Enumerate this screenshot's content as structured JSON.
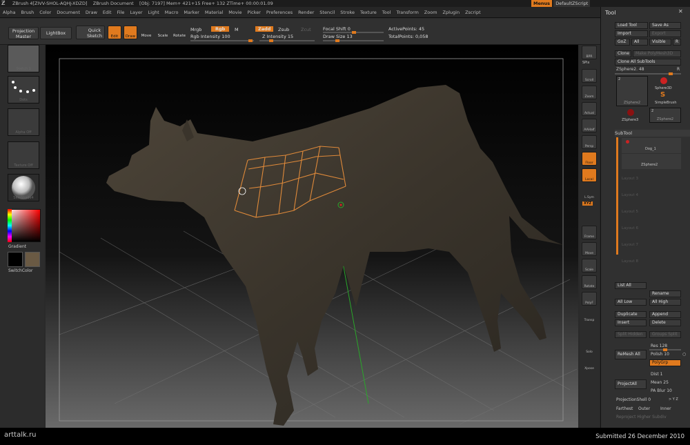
{
  "titlebar": {
    "app": "ZBrush 4[ZIVV-SHOL-AQHJ-XDZD]",
    "doc": "ZBrush Document",
    "info": "[Obj: 7197]  Mem+ 421+15  Free+ 132  ZTime+ 00:00:01.09"
  },
  "topright": {
    "menus": "Menus",
    "script": "DefaultZScript"
  },
  "menubar": [
    "Alpha",
    "Brush",
    "Color",
    "Document",
    "Draw",
    "Edit",
    "File",
    "Layer",
    "Light",
    "Macro",
    "Marker",
    "Material",
    "Movie",
    "Picker",
    "Preferences",
    "Render",
    "Stencil",
    "Stroke",
    "Texture",
    "Tool",
    "Transform",
    "Zoom",
    "Zplugin",
    "Zscript"
  ],
  "toolbar": {
    "projection_master": "Projection Master",
    "lightbox": "LightBox",
    "quick_sketch": "Quick Sketch",
    "edit": "Edit",
    "draw": "Draw",
    "move": "Move",
    "scale": "Scale",
    "rotate": "Rotate",
    "mrgb": "Mrgb",
    "rgb": "Rgb",
    "m": "M",
    "rgb_intensity": "Rgb Intensity 100",
    "zadd": "Zadd",
    "zsub": "Zsub",
    "zcut": "Zcut",
    "z_intensity": "Z Intensity 15",
    "focal_shift": "Focal Shift 0",
    "draw_size": "Draw Size 13",
    "active_points": "ActivePoints: 45",
    "total_points": "TotalPoints: 0,058"
  },
  "leftshelf": {
    "thumb1": "Sketch 1",
    "thumb2": "Dots",
    "thumb3": "Alpha Off",
    "thumb4": "Texture Off",
    "thumb5": "SkinShade4",
    "gradient": "Gradient",
    "switchcolor": "SwitchColor"
  },
  "rightshelf": [
    "BPR",
    "SPix",
    "Scroll",
    "Zoom",
    "Actual",
    "AAHalf",
    "Persp",
    "Floor",
    "Local",
    "L.Sym",
    "XYZ",
    "Frame",
    "Move",
    "Scale",
    "Rotate",
    "PolyF",
    "Transp",
    "Solo",
    "Xpose"
  ],
  "panel": {
    "title": "Tool",
    "load": "Load Tool",
    "saveas": "Save As",
    "import": "Import",
    "export": "Export",
    "goz": "GoZ",
    "all": "All",
    "visible": "Visible",
    "r": "R",
    "clone": "Clone",
    "make_poly": "Make PolyMesh3D",
    "clone_all": "Clone All SubTools",
    "zsphere": "ZSphere2. 48",
    "r2": "R",
    "t_count": "2",
    "t1": "ZSphere2",
    "t2": "Sphere3D",
    "t3": "SimpleBrush",
    "t4": "ZSphere3",
    "t5_count": "2",
    "t5": "ZSphere2",
    "subtool": "SubTool",
    "st1": "Dog_1",
    "st2": "ZSphere2",
    "layers": [
      "Layout 3",
      "Layout 4",
      "Layout 5",
      "Layout 6",
      "Layout 7",
      "Layout 8"
    ],
    "list_all": "List All",
    "rename": "Rename",
    "all_low": "All Low",
    "all_high": "All High",
    "duplicate": "Duplicate",
    "append": "Append",
    "insert": "Insert",
    "delete": "Delete",
    "split_hidden": "Split Hidden",
    "groups_split": "Groups Split",
    "remesh_all": "ReMesh All",
    "res": "Res 128",
    "polish": "Polish 10",
    "polygrp": "PolyGrp",
    "project_all": "ProjectAll",
    "dist": "Dist 1",
    "mean": "Mean 25",
    "pa_blur": "PA Blur 10",
    "projection_shell": "ProjectionShell 0",
    "xyz": "> Y Z",
    "farthest": "Farthest",
    "outer": "Outer",
    "inner": "Inner",
    "reproject_higher": "Reproject Higher Subdiv"
  },
  "footer": {
    "site": "arttalk.ru",
    "submitted": "Submitted 26 December 2010"
  }
}
